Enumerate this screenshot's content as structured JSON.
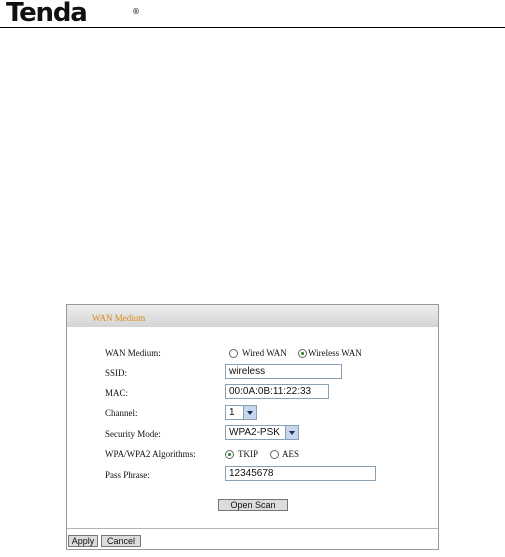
{
  "brand": {
    "logo_text": "Tenda",
    "reg_mark": "®"
  },
  "panel": {
    "title": "WAN Medium",
    "fields": {
      "wan_medium": {
        "label": "WAN Medium:",
        "options": [
          "Wired WAN",
          "Wireless WAN"
        ],
        "selected": "Wireless WAN"
      },
      "ssid": {
        "label": "SSID:",
        "value": "wireless"
      },
      "mac": {
        "label": "MAC:",
        "value": "00:0A:0B:11:22:33"
      },
      "channel": {
        "label": "Channel:",
        "value": "1"
      },
      "security_mode": {
        "label": "Security Mode:",
        "value": "WPA2-PSK"
      },
      "algorithms": {
        "label": "WPA/WPA2 Algorithms:",
        "options": [
          "TKIP",
          "AES"
        ],
        "selected": "TKIP"
      },
      "pass_phrase": {
        "label": "Pass Phrase:",
        "value": "12345678"
      }
    },
    "buttons": {
      "open_scan": "Open Scan",
      "apply": "Apply",
      "cancel": "Cancel"
    }
  }
}
